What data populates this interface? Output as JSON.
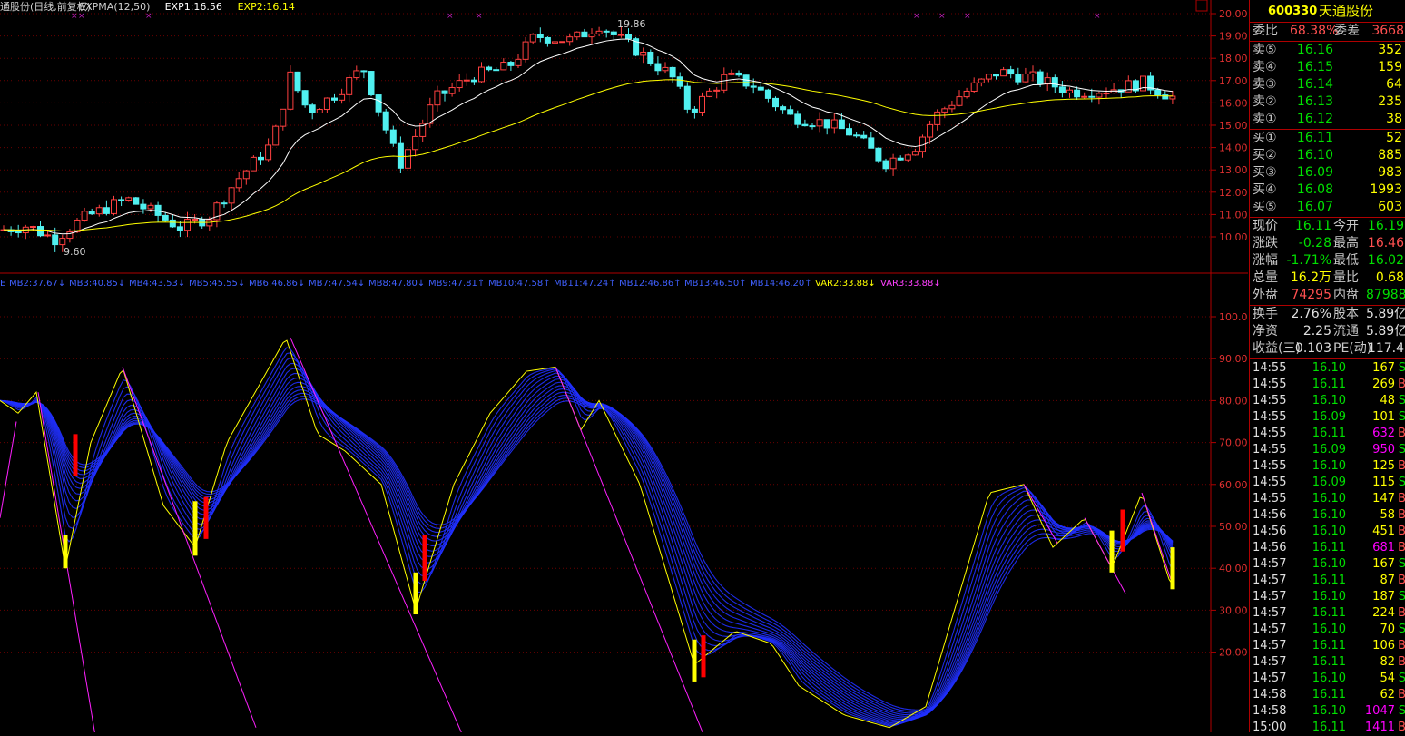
{
  "upper": {
    "legend": [
      {
        "text": "通股份(日线,前复权)",
        "color": "#d0d0d0"
      },
      {
        "text": "EXPMA(12,50)",
        "color": "#d0d0d0"
      },
      {
        "text": "EXP1:16.56",
        "color": "#ffffff"
      },
      {
        "text": "EXP2:16.14",
        "color": "#ffff00"
      }
    ],
    "axis_labels": [
      "20.00",
      "19.00",
      "18.00",
      "17.00",
      "16.00",
      "15.00",
      "14.00",
      "13.00",
      "12.00",
      "11.00",
      "10.00"
    ],
    "high_label": "19.86",
    "low_label": "9.60"
  },
  "lower": {
    "legend": [
      {
        "text": "E",
        "color": "#4060ff"
      },
      {
        "text": "MB2:37.67↓",
        "color": "#4060ff"
      },
      {
        "text": "MB3:40.85↓",
        "color": "#4060ff"
      },
      {
        "text": "MB4:43.53↓",
        "color": "#4060ff"
      },
      {
        "text": "MB5:45.55↓",
        "color": "#4060ff"
      },
      {
        "text": "MB6:46.86↓",
        "color": "#4060ff"
      },
      {
        "text": "MB7:47.54↓",
        "color": "#4060ff"
      },
      {
        "text": "MB8:47.80↓",
        "color": "#4060ff"
      },
      {
        "text": "MB9:47.81↑",
        "color": "#4060ff"
      },
      {
        "text": "MB10:47.58↑",
        "color": "#4060ff"
      },
      {
        "text": "MB11:47.24↑",
        "color": "#4060ff"
      },
      {
        "text": "MB12:46.86↑",
        "color": "#4060ff"
      },
      {
        "text": "MB13:46.50↑",
        "color": "#4060ff"
      },
      {
        "text": "MB14:46.20↑",
        "color": "#4060ff"
      },
      {
        "text": "VAR2:33.88↓",
        "color": "#ffff00"
      },
      {
        "text": "VAR3:33.88↓",
        "color": "#ff40ff"
      }
    ],
    "axis_labels": [
      "100.0",
      "90.00",
      "80.00",
      "70.00",
      "60.00",
      "50.00",
      "40.00",
      "30.00",
      "20.00"
    ]
  },
  "side": {
    "code": "600330",
    "name": "天通股份",
    "weibi_label": "委比",
    "weibi": "68.38%",
    "weicha_label": "委差",
    "weicha": "3668",
    "sells": [
      {
        "label": "卖⑤",
        "price": "16.16",
        "vol": "352"
      },
      {
        "label": "卖④",
        "price": "16.15",
        "vol": "159"
      },
      {
        "label": "卖③",
        "price": "16.14",
        "vol": "64"
      },
      {
        "label": "卖②",
        "price": "16.13",
        "vol": "235"
      },
      {
        "label": "卖①",
        "price": "16.12",
        "vol": "38"
      }
    ],
    "buys": [
      {
        "label": "买①",
        "price": "16.11",
        "vol": "52"
      },
      {
        "label": "买②",
        "price": "16.10",
        "vol": "885"
      },
      {
        "label": "买③",
        "price": "16.09",
        "vol": "983"
      },
      {
        "label": "买④",
        "price": "16.08",
        "vol": "1993"
      },
      {
        "label": "买⑤",
        "price": "16.07",
        "vol": "603"
      }
    ],
    "quote": [
      {
        "l1": "现价",
        "v1": "16.11",
        "c1": "g",
        "l2": "今开",
        "v2": "16.19",
        "c2": "g"
      },
      {
        "l1": "涨跌",
        "v1": "-0.28",
        "c1": "g",
        "l2": "最高",
        "v2": "16.46",
        "c2": "r"
      },
      {
        "l1": "涨幅",
        "v1": "-1.71%",
        "c1": "g",
        "l2": "最低",
        "v2": "16.02",
        "c2": "g"
      },
      {
        "l1": "总量",
        "v1": "16.2万",
        "c1": "y",
        "l2": "量比",
        "v2": "0.68",
        "c2": "y"
      },
      {
        "l1": "外盘",
        "v1": "74295",
        "c1": "r",
        "l2": "内盘",
        "v2": "87988",
        "c2": "g"
      }
    ],
    "finance": [
      {
        "l1": "换手",
        "v1": "2.76%",
        "l2": "股本",
        "v2": "5.89亿"
      },
      {
        "l1": "净资",
        "v1": "2.25",
        "l2": "流通",
        "v2": "5.89亿"
      },
      {
        "l1": "收益(三)",
        "v1": "0.103",
        "l2": "PE(动)",
        "v2": "117.4"
      }
    ],
    "ticks": [
      {
        "t": "14:55",
        "p": "16.10",
        "pc": "g",
        "v": "167",
        "vc": "y",
        "s": "S"
      },
      {
        "t": "14:55",
        "p": "16.11",
        "pc": "g",
        "v": "269",
        "vc": "y",
        "s": "B"
      },
      {
        "t": "14:55",
        "p": "16.10",
        "pc": "g",
        "v": "48",
        "vc": "y",
        "s": "S"
      },
      {
        "t": "14:55",
        "p": "16.09",
        "pc": "g",
        "v": "101",
        "vc": "y",
        "s": "S"
      },
      {
        "t": "14:55",
        "p": "16.11",
        "pc": "g",
        "v": "632",
        "vc": "m",
        "s": "B"
      },
      {
        "t": "14:55",
        "p": "16.09",
        "pc": "g",
        "v": "950",
        "vc": "m",
        "s": "S"
      },
      {
        "t": "14:55",
        "p": "16.10",
        "pc": "g",
        "v": "125",
        "vc": "y",
        "s": "B"
      },
      {
        "t": "14:55",
        "p": "16.09",
        "pc": "g",
        "v": "115",
        "vc": "y",
        "s": "S"
      },
      {
        "t": "14:55",
        "p": "16.10",
        "pc": "g",
        "v": "147",
        "vc": "y",
        "s": "B"
      },
      {
        "t": "14:56",
        "p": "16.10",
        "pc": "g",
        "v": "58",
        "vc": "y",
        "s": "B"
      },
      {
        "t": "14:56",
        "p": "16.10",
        "pc": "g",
        "v": "451",
        "vc": "y",
        "s": "B"
      },
      {
        "t": "14:56",
        "p": "16.11",
        "pc": "g",
        "v": "681",
        "vc": "m",
        "s": "B"
      },
      {
        "t": "14:57",
        "p": "16.10",
        "pc": "g",
        "v": "167",
        "vc": "y",
        "s": "S"
      },
      {
        "t": "14:57",
        "p": "16.11",
        "pc": "g",
        "v": "87",
        "vc": "y",
        "s": "B"
      },
      {
        "t": "14:57",
        "p": "16.10",
        "pc": "g",
        "v": "187",
        "vc": "y",
        "s": "S"
      },
      {
        "t": "14:57",
        "p": "16.11",
        "pc": "g",
        "v": "224",
        "vc": "y",
        "s": "B"
      },
      {
        "t": "14:57",
        "p": "16.10",
        "pc": "g",
        "v": "70",
        "vc": "y",
        "s": "S"
      },
      {
        "t": "14:57",
        "p": "16.11",
        "pc": "g",
        "v": "106",
        "vc": "y",
        "s": "B"
      },
      {
        "t": "14:57",
        "p": "16.11",
        "pc": "g",
        "v": "82",
        "vc": "y",
        "s": "B"
      },
      {
        "t": "14:57",
        "p": "16.10",
        "pc": "g",
        "v": "54",
        "vc": "y",
        "s": "S"
      },
      {
        "t": "14:58",
        "p": "16.11",
        "pc": "g",
        "v": "62",
        "vc": "y",
        "s": "B"
      },
      {
        "t": "14:58",
        "p": "16.10",
        "pc": "g",
        "v": "1047",
        "vc": "m",
        "s": "S"
      },
      {
        "t": "15:00",
        "p": "16.11",
        "pc": "g",
        "v": "1411",
        "vc": "m",
        "s": "B"
      }
    ]
  }
}
